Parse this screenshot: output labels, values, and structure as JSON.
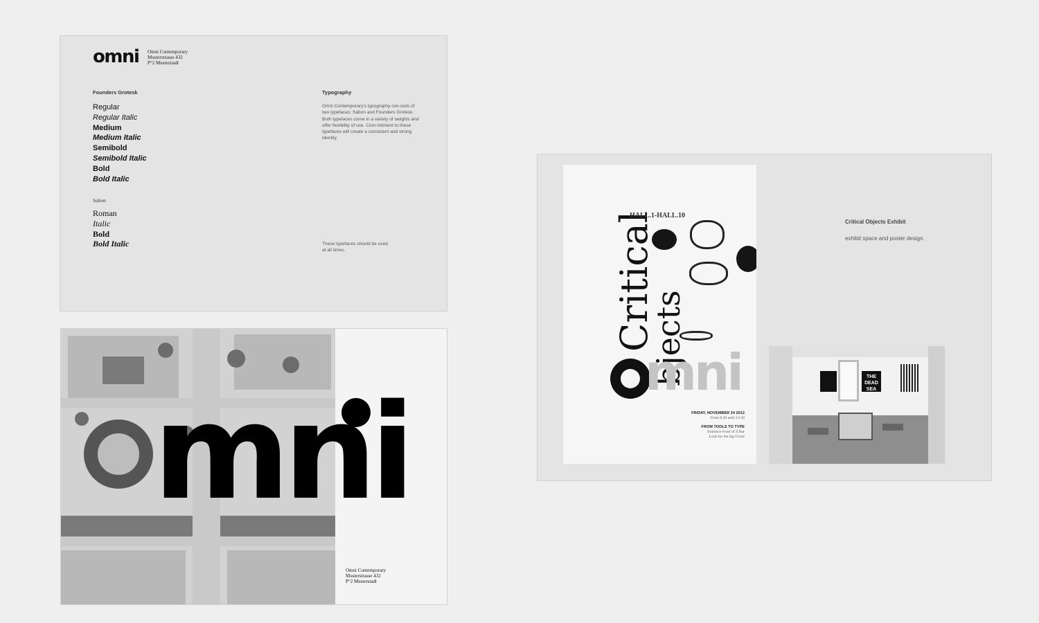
{
  "type_page": {
    "logo": "omni",
    "address": [
      "Omni Contemporary",
      "Musterstrasse 432",
      "P°2 Musterstadt"
    ],
    "sans_heading": "Founders Grotesk",
    "sans_weights": [
      "Regular",
      "Regular Italic",
      "Medium",
      "Medium Italic",
      "Semibold",
      "Semibold Italic",
      "Bold",
      "Bold Italic"
    ],
    "serif_heading": "Sabon",
    "serif_weights": [
      "Roman",
      "Italic",
      "Bold",
      "Bold Italic"
    ],
    "typo_heading": "Typography",
    "typo_body": "Omni Contemporary's typography con-sists of two typefaces: Sabon and Founders Grotesk. Both typefaces come in a variety of weights and offer flexibility of use. Com-mitment to these typefaces will create a consistent and strong identity.",
    "typo_note": "These typefaces should be used at all times."
  },
  "aerial_page": {
    "wordmark": "mni",
    "address": [
      "Omni Contemporary",
      "Musterstrasse 432",
      "P°2 Musterstadt"
    ]
  },
  "exhibit_page": {
    "poster": {
      "title_line1": "Critical",
      "title_line2": "bjects",
      "wordmark": "mni",
      "hall": "HALL.1-HALL.10",
      "date": "FRIDAY, NOVEMBER 24 2012",
      "time": "From 8:30 until 12:30",
      "event": "FROM TOOLS TO TYPE",
      "entrance": "Entrance Front of Z Bar",
      "hint": "Look for the big Circle"
    },
    "title": "Critical Objects Exhibit",
    "subtitle": "exhibit space and poster design.",
    "photo_art_text": "THE DEAD SEA"
  }
}
